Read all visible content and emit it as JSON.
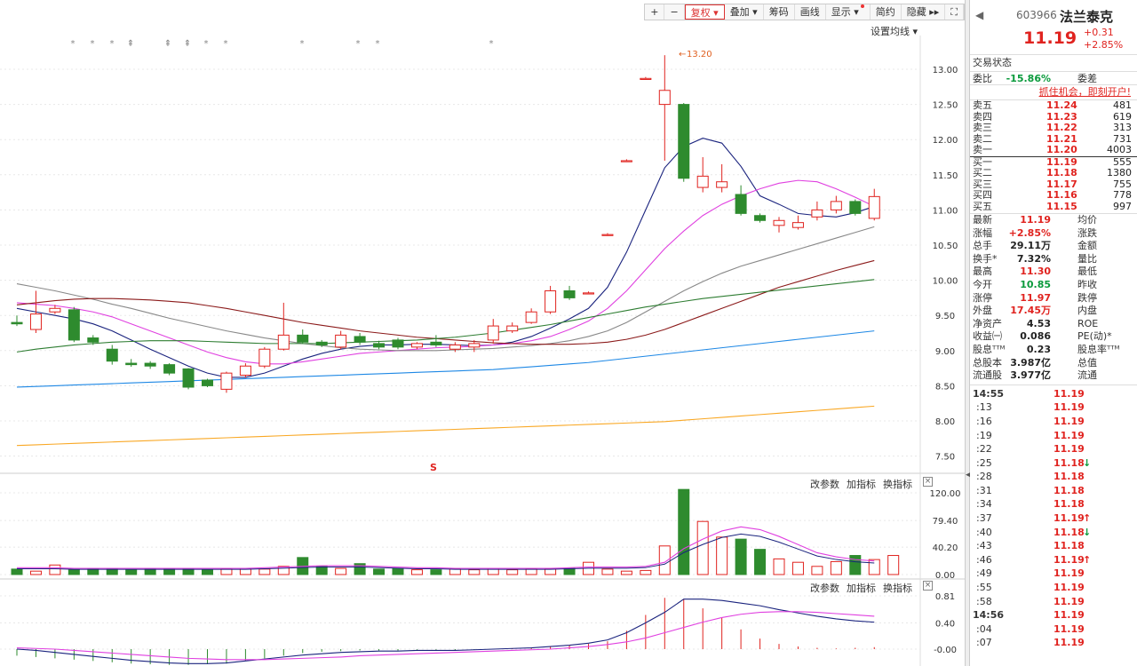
{
  "toolbar": {
    "items": [
      {
        "label": "+"
      },
      {
        "label": "−"
      },
      {
        "label": "复权 ▾",
        "active": true
      },
      {
        "label": "叠加 ▾"
      },
      {
        "label": "筹码"
      },
      {
        "label": "画线"
      },
      {
        "label": "显示 ▾",
        "dot": true
      },
      {
        "label": "简约"
      },
      {
        "label": "隐藏 ▸▸"
      },
      {
        "label": "⛶"
      }
    ]
  },
  "ma_setting_label": "设置均线 ▾",
  "panel_menu": {
    "change_params": "改参数",
    "add_indicator": "加指标",
    "switch_indicator": "换指标",
    "close": "×"
  },
  "chart_data": {
    "type": "candlestick",
    "price_axis": {
      "ticks": [
        "13.00",
        "12.50",
        "12.00",
        "11.50",
        "11.00",
        "10.50",
        "10.00",
        "9.50",
        "9.00",
        "8.50",
        "8.00",
        "7.50"
      ],
      "ylim": [
        7.5,
        13.0
      ]
    },
    "peak_annotation": "13.20",
    "candles": [
      {
        "o": 9.4,
        "h": 9.5,
        "l": 9.35,
        "c": 9.38
      },
      {
        "o": 9.3,
        "h": 9.85,
        "l": 9.25,
        "c": 9.52
      },
      {
        "o": 9.55,
        "h": 9.65,
        "l": 9.52,
        "c": 9.6
      },
      {
        "o": 9.58,
        "h": 9.62,
        "l": 9.12,
        "c": 9.15
      },
      {
        "o": 9.18,
        "h": 9.22,
        "l": 9.08,
        "c": 9.12
      },
      {
        "o": 9.02,
        "h": 9.08,
        "l": 8.8,
        "c": 8.85
      },
      {
        "o": 8.82,
        "h": 8.88,
        "l": 8.77,
        "c": 8.8
      },
      {
        "o": 8.82,
        "h": 8.85,
        "l": 8.74,
        "c": 8.78
      },
      {
        "o": 8.8,
        "h": 8.82,
        "l": 8.65,
        "c": 8.68
      },
      {
        "o": 8.74,
        "h": 8.75,
        "l": 8.45,
        "c": 8.48
      },
      {
        "o": 8.58,
        "h": 8.6,
        "l": 8.48,
        "c": 8.5
      },
      {
        "o": 8.45,
        "h": 8.7,
        "l": 8.4,
        "c": 8.68
      },
      {
        "o": 8.65,
        "h": 8.82,
        "l": 8.62,
        "c": 8.78
      },
      {
        "o": 8.78,
        "h": 9.05,
        "l": 8.75,
        "c": 9.02
      },
      {
        "o": 9.02,
        "h": 9.68,
        "l": 9.0,
        "c": 9.22
      },
      {
        "o": 9.22,
        "h": 9.3,
        "l": 9.1,
        "c": 9.12
      },
      {
        "o": 9.12,
        "h": 9.15,
        "l": 9.05,
        "c": 9.08
      },
      {
        "o": 9.05,
        "h": 9.28,
        "l": 9.02,
        "c": 9.22
      },
      {
        "o": 9.2,
        "h": 9.25,
        "l": 9.08,
        "c": 9.12
      },
      {
        "o": 9.1,
        "h": 9.14,
        "l": 9.02,
        "c": 9.05
      },
      {
        "o": 9.15,
        "h": 9.18,
        "l": 9.02,
        "c": 9.05
      },
      {
        "o": 9.05,
        "h": 9.12,
        "l": 9.02,
        "c": 9.1
      },
      {
        "o": 9.12,
        "h": 9.22,
        "l": 9.05,
        "c": 9.08
      },
      {
        "o": 9.02,
        "h": 9.12,
        "l": 8.98,
        "c": 9.08
      },
      {
        "o": 9.05,
        "h": 9.15,
        "l": 8.98,
        "c": 9.1
      },
      {
        "o": 9.15,
        "h": 9.45,
        "l": 9.1,
        "c": 9.35
      },
      {
        "o": 9.28,
        "h": 9.4,
        "l": 9.25,
        "c": 9.35
      },
      {
        "o": 9.4,
        "h": 9.6,
        "l": 9.38,
        "c": 9.55
      },
      {
        "o": 9.55,
        "h": 9.92,
        "l": 9.52,
        "c": 9.85
      },
      {
        "o": 9.85,
        "h": 9.92,
        "l": 9.72,
        "c": 9.75
      },
      {
        "o": 9.82,
        "h": 9.84,
        "l": 9.8,
        "c": 9.82
      },
      {
        "o": 10.65,
        "h": 10.67,
        "l": 10.63,
        "c": 10.65
      },
      {
        "o": 11.7,
        "h": 11.72,
        "l": 11.68,
        "c": 11.7
      },
      {
        "o": 12.87,
        "h": 12.89,
        "l": 12.85,
        "c": 12.87
      },
      {
        "o": 12.5,
        "h": 13.2,
        "l": 11.7,
        "c": 12.7
      },
      {
        "o": 12.5,
        "h": 12.52,
        "l": 11.4,
        "c": 11.45
      },
      {
        "o": 11.32,
        "h": 11.75,
        "l": 11.25,
        "c": 11.48
      },
      {
        "o": 11.32,
        "h": 11.65,
        "l": 11.25,
        "c": 11.4
      },
      {
        "o": 11.22,
        "h": 11.35,
        "l": 10.92,
        "c": 10.95
      },
      {
        "o": 10.92,
        "h": 10.95,
        "l": 10.82,
        "c": 10.85
      },
      {
        "o": 10.78,
        "h": 10.9,
        "l": 10.68,
        "c": 10.85
      },
      {
        "o": 10.75,
        "h": 10.92,
        "l": 10.72,
        "c": 10.82
      },
      {
        "o": 10.9,
        "h": 11.12,
        "l": 10.85,
        "c": 11.0
      },
      {
        "o": 11.0,
        "h": 11.2,
        "l": 10.95,
        "c": 11.12
      },
      {
        "o": 11.12,
        "h": 11.15,
        "l": 10.92,
        "c": 10.95
      },
      {
        "o": 10.88,
        "h": 11.3,
        "l": 10.85,
        "c": 11.19
      }
    ],
    "ma_lines": [
      {
        "color": "#1a237e",
        "values": [
          9.6,
          9.55,
          9.5,
          9.45,
          9.38,
          9.28,
          9.15,
          9.02,
          8.9,
          8.78,
          8.68,
          8.62,
          8.62,
          8.68,
          8.78,
          8.88,
          8.96,
          9.02,
          9.06,
          9.08,
          9.08,
          9.09,
          9.09,
          9.08,
          9.07,
          9.08,
          9.12,
          9.2,
          9.32,
          9.45,
          9.6,
          9.9,
          10.4,
          11.0,
          11.6,
          11.9,
          12.02,
          11.95,
          11.62,
          11.2,
          11.08,
          10.95,
          10.92,
          10.9,
          10.96,
          11.05
        ]
      },
      {
        "color": "#e040e0",
        "values": [
          9.68,
          9.66,
          9.64,
          9.6,
          9.55,
          9.48,
          9.38,
          9.28,
          9.18,
          9.08,
          8.98,
          8.9,
          8.84,
          8.81,
          8.81,
          8.84,
          8.88,
          8.92,
          8.96,
          8.98,
          9.0,
          9.02,
          9.04,
          9.05,
          9.06,
          9.08,
          9.1,
          9.14,
          9.2,
          9.3,
          9.42,
          9.6,
          9.85,
          10.15,
          10.45,
          10.7,
          10.92,
          11.08,
          11.2,
          11.3,
          11.38,
          11.42,
          11.4,
          11.3,
          11.18,
          11.05
        ]
      },
      {
        "color": "#888888",
        "values": [
          9.95,
          9.9,
          9.85,
          9.79,
          9.73,
          9.66,
          9.6,
          9.53,
          9.46,
          9.4,
          9.34,
          9.28,
          9.23,
          9.18,
          9.14,
          9.1,
          9.07,
          9.04,
          9.02,
          9.01,
          9.0,
          9.0,
          9.0,
          9.01,
          9.02,
          9.03,
          9.05,
          9.07,
          9.1,
          9.14,
          9.2,
          9.28,
          9.4,
          9.55,
          9.7,
          9.85,
          9.98,
          10.1,
          10.2,
          10.28,
          10.36,
          10.44,
          10.52,
          10.6,
          10.68,
          10.76
        ]
      },
      {
        "color": "#8b1a1a",
        "values": [
          9.65,
          9.68,
          9.71,
          9.73,
          9.74,
          9.74,
          9.73,
          9.72,
          9.7,
          9.68,
          9.64,
          9.6,
          9.55,
          9.5,
          9.45,
          9.4,
          9.36,
          9.32,
          9.28,
          9.25,
          9.22,
          9.19,
          9.17,
          9.15,
          9.13,
          9.11,
          9.1,
          9.09,
          9.09,
          9.09,
          9.1,
          9.12,
          9.16,
          9.22,
          9.3,
          9.4,
          9.5,
          9.6,
          9.7,
          9.8,
          9.9,
          9.98,
          10.06,
          10.14,
          10.21,
          10.28
        ]
      },
      {
        "color": "#2e7d32",
        "values": [
          8.98,
          9.02,
          9.05,
          9.08,
          9.1,
          9.12,
          9.13,
          9.14,
          9.14,
          9.14,
          9.13,
          9.12,
          9.11,
          9.1,
          9.1,
          9.1,
          9.1,
          9.11,
          9.12,
          9.13,
          9.14,
          9.15,
          9.17,
          9.19,
          9.22,
          9.25,
          9.29,
          9.33,
          9.37,
          9.42,
          9.47,
          9.52,
          9.57,
          9.62,
          9.66,
          9.7,
          9.74,
          9.77,
          9.8,
          9.83,
          9.86,
          9.89,
          9.92,
          9.95,
          9.98,
          10.01
        ]
      },
      {
        "color": "#1e88e5",
        "values": [
          8.48,
          8.49,
          8.5,
          8.51,
          8.52,
          8.53,
          8.54,
          8.55,
          8.56,
          8.57,
          8.58,
          8.59,
          8.6,
          8.61,
          8.62,
          8.63,
          8.64,
          8.65,
          8.66,
          8.67,
          8.68,
          8.69,
          8.7,
          8.71,
          8.72,
          8.73,
          8.75,
          8.77,
          8.79,
          8.81,
          8.83,
          8.86,
          8.89,
          8.92,
          8.95,
          8.98,
          9.01,
          9.04,
          9.07,
          9.1,
          9.13,
          9.16,
          9.19,
          9.22,
          9.25,
          9.28
        ]
      },
      {
        "color": "#f9a825",
        "values": [
          7.65,
          7.66,
          7.67,
          7.68,
          7.69,
          7.7,
          7.71,
          7.72,
          7.73,
          7.74,
          7.75,
          7.76,
          7.77,
          7.78,
          7.79,
          7.8,
          7.81,
          7.82,
          7.83,
          7.84,
          7.85,
          7.86,
          7.87,
          7.88,
          7.89,
          7.9,
          7.91,
          7.92,
          7.93,
          7.94,
          7.95,
          7.96,
          7.97,
          7.98,
          7.99,
          8.01,
          8.03,
          8.05,
          8.07,
          8.09,
          8.11,
          8.13,
          8.15,
          8.17,
          8.19,
          8.21
        ]
      }
    ],
    "event_markers": [
      "*",
      "*",
      "*",
      "⇞",
      "⇞",
      "⇞",
      "*",
      "*",
      "*",
      "*",
      "*",
      "*"
    ],
    "signal_marker": "S",
    "volume_axis": {
      "ticks": [
        "120.00",
        "79.40",
        "40.20",
        "0.00"
      ],
      "ylim": [
        0,
        120
      ]
    },
    "volume": [
      8,
      5,
      14,
      7,
      8,
      8,
      7,
      9,
      8,
      9,
      7,
      8,
      9,
      8,
      12,
      25,
      12,
      9,
      16,
      8,
      9,
      7,
      7,
      8,
      7,
      9,
      7,
      8,
      8,
      9,
      18,
      8,
      5,
      6,
      42,
      125,
      78,
      55,
      52,
      37,
      23,
      18,
      12,
      19,
      28,
      22,
      28
    ],
    "volume_ma": [
      10,
      10,
      10,
      9,
      9,
      9,
      9,
      9,
      9,
      9,
      9,
      9,
      9,
      10,
      11,
      12,
      13,
      13,
      13,
      12,
      11,
      10,
      10,
      9,
      9,
      9,
      9,
      9,
      9,
      10,
      11,
      11,
      11,
      12,
      18,
      38,
      52,
      64,
      70,
      66,
      56,
      44,
      32,
      26,
      22,
      20
    ],
    "macd_axis": {
      "ticks": [
        "0.81",
        "0.40",
        "-0.00"
      ],
      "ylim": [
        -0.25,
        0.95
      ]
    },
    "macd_hist": [
      -0.1,
      -0.12,
      -0.14,
      -0.16,
      -0.18,
      -0.2,
      -0.22,
      -0.23,
      -0.24,
      -0.24,
      -0.23,
      -0.22,
      -0.18,
      -0.14,
      -0.1,
      -0.06,
      -0.04,
      -0.03,
      -0.02,
      -0.02,
      -0.02,
      -0.01,
      -0.01,
      -0.02,
      -0.01,
      0.0,
      0.01,
      0.02,
      0.04,
      0.06,
      0.08,
      0.12,
      0.28,
      0.52,
      0.78,
      0.76,
      0.62,
      0.48,
      0.3,
      0.16,
      0.08,
      0.04,
      0.02,
      0.01,
      0.02,
      0.03
    ],
    "macd_dif": [
      0.0,
      -0.02,
      -0.05,
      -0.08,
      -0.11,
      -0.14,
      -0.17,
      -0.19,
      -0.21,
      -0.22,
      -0.22,
      -0.21,
      -0.18,
      -0.15,
      -0.12,
      -0.09,
      -0.07,
      -0.05,
      -0.04,
      -0.03,
      -0.03,
      -0.02,
      -0.02,
      -0.02,
      -0.01,
      0.0,
      0.01,
      0.02,
      0.04,
      0.06,
      0.09,
      0.14,
      0.25,
      0.4,
      0.56,
      0.76,
      0.76,
      0.74,
      0.7,
      0.66,
      0.6,
      0.55,
      0.5,
      0.46,
      0.43,
      0.41
    ],
    "macd_dea": [
      0.02,
      0.01,
      0.0,
      -0.02,
      -0.04,
      -0.06,
      -0.08,
      -0.1,
      -0.12,
      -0.14,
      -0.15,
      -0.16,
      -0.16,
      -0.16,
      -0.15,
      -0.14,
      -0.13,
      -0.12,
      -0.1,
      -0.09,
      -0.08,
      -0.07,
      -0.06,
      -0.05,
      -0.04,
      -0.03,
      -0.02,
      -0.01,
      0.0,
      0.02,
      0.04,
      0.07,
      0.11,
      0.17,
      0.25,
      0.33,
      0.41,
      0.48,
      0.53,
      0.56,
      0.57,
      0.57,
      0.56,
      0.54,
      0.52,
      0.5
    ]
  },
  "quote": {
    "back_icon": "◀",
    "code": "603966",
    "name": "法兰泰克",
    "price": "11.19",
    "change": "+0.31",
    "change_pct": "+2.85%",
    "trade_status": "交易状态",
    "weibi": {
      "label": "委比",
      "value": "-15.86%",
      "label2": "委差"
    },
    "promo": "抓住机会，即刻开户!",
    "asks": [
      {
        "label": "卖五",
        "price": "11.24",
        "qty": "481"
      },
      {
        "label": "卖四",
        "price": "11.23",
        "qty": "619"
      },
      {
        "label": "卖三",
        "price": "11.22",
        "qty": "313"
      },
      {
        "label": "卖二",
        "price": "11.21",
        "qty": "731"
      },
      {
        "label": "卖一",
        "price": "11.20",
        "qty": "4003"
      }
    ],
    "bids": [
      {
        "label": "买一",
        "price": "11.19",
        "qty": "555"
      },
      {
        "label": "买二",
        "price": "11.18",
        "qty": "1380"
      },
      {
        "label": "买三",
        "price": "11.17",
        "qty": "755"
      },
      {
        "label": "买四",
        "price": "11.16",
        "qty": "778"
      },
      {
        "label": "买五",
        "price": "11.15",
        "qty": "997"
      }
    ],
    "stats": [
      {
        "l": "最新",
        "v": "11.19",
        "c": "red",
        "r": "均价"
      },
      {
        "l": "涨幅",
        "v": "+2.85%",
        "c": "red",
        "r": "涨跌"
      },
      {
        "l": "总手",
        "v": "29.11万",
        "c": "dark",
        "r": "金额"
      },
      {
        "l": "换手*",
        "v": "7.32%",
        "c": "dark",
        "r": "量比"
      },
      {
        "l": "最高",
        "v": "11.30",
        "c": "red",
        "r": "最低"
      },
      {
        "l": "今开",
        "v": "10.85",
        "c": "green",
        "r": "昨收"
      },
      {
        "l": "涨停",
        "v": "11.97",
        "c": "red",
        "r": "跌停"
      },
      {
        "l": "外盘",
        "v": "17.45万",
        "c": "red",
        "r": "内盘"
      },
      {
        "l": "净资产",
        "v": "4.53",
        "c": "dark",
        "r": "ROE"
      },
      {
        "l": "收益㈠",
        "v": "0.086",
        "c": "dark",
        "r": "PE(动)*"
      },
      {
        "l": "股息ᵀᵀᴹ",
        "v": "0.23",
        "c": "dark",
        "r": "股息率ᵀᵀᴹ"
      },
      {
        "l": "总股本",
        "v": "3.987亿",
        "c": "dark",
        "r": "总值"
      },
      {
        "l": "流通股",
        "v": "3.977亿",
        "c": "dark",
        "r": "流通"
      }
    ],
    "ticks": [
      {
        "t": "14:55",
        "p": "11.19",
        "a": "",
        "full": true
      },
      {
        "t": ":13",
        "p": "11.19",
        "a": ""
      },
      {
        "t": ":16",
        "p": "11.19",
        "a": ""
      },
      {
        "t": ":19",
        "p": "11.19",
        "a": ""
      },
      {
        "t": ":22",
        "p": "11.19",
        "a": ""
      },
      {
        "t": ":25",
        "p": "11.18",
        "a": "↓",
        "ac": "green"
      },
      {
        "t": ":28",
        "p": "11.18",
        "a": ""
      },
      {
        "t": ":31",
        "p": "11.18",
        "a": ""
      },
      {
        "t": ":34",
        "p": "11.18",
        "a": ""
      },
      {
        "t": ":37",
        "p": "11.19",
        "a": "↑",
        "ac": "red"
      },
      {
        "t": ":40",
        "p": "11.18",
        "a": "↓",
        "ac": "green"
      },
      {
        "t": ":43",
        "p": "11.18",
        "a": ""
      },
      {
        "t": ":46",
        "p": "11.19",
        "a": "↑",
        "ac": "red"
      },
      {
        "t": ":49",
        "p": "11.19",
        "a": ""
      },
      {
        "t": ":55",
        "p": "11.19",
        "a": ""
      },
      {
        "t": ":58",
        "p": "11.19",
        "a": ""
      },
      {
        "t": "14:56",
        "p": "11.19",
        "a": "",
        "full": true
      },
      {
        "t": ":04",
        "p": "11.19",
        "a": ""
      },
      {
        "t": ":07",
        "p": "11.19",
        "a": ""
      }
    ]
  }
}
